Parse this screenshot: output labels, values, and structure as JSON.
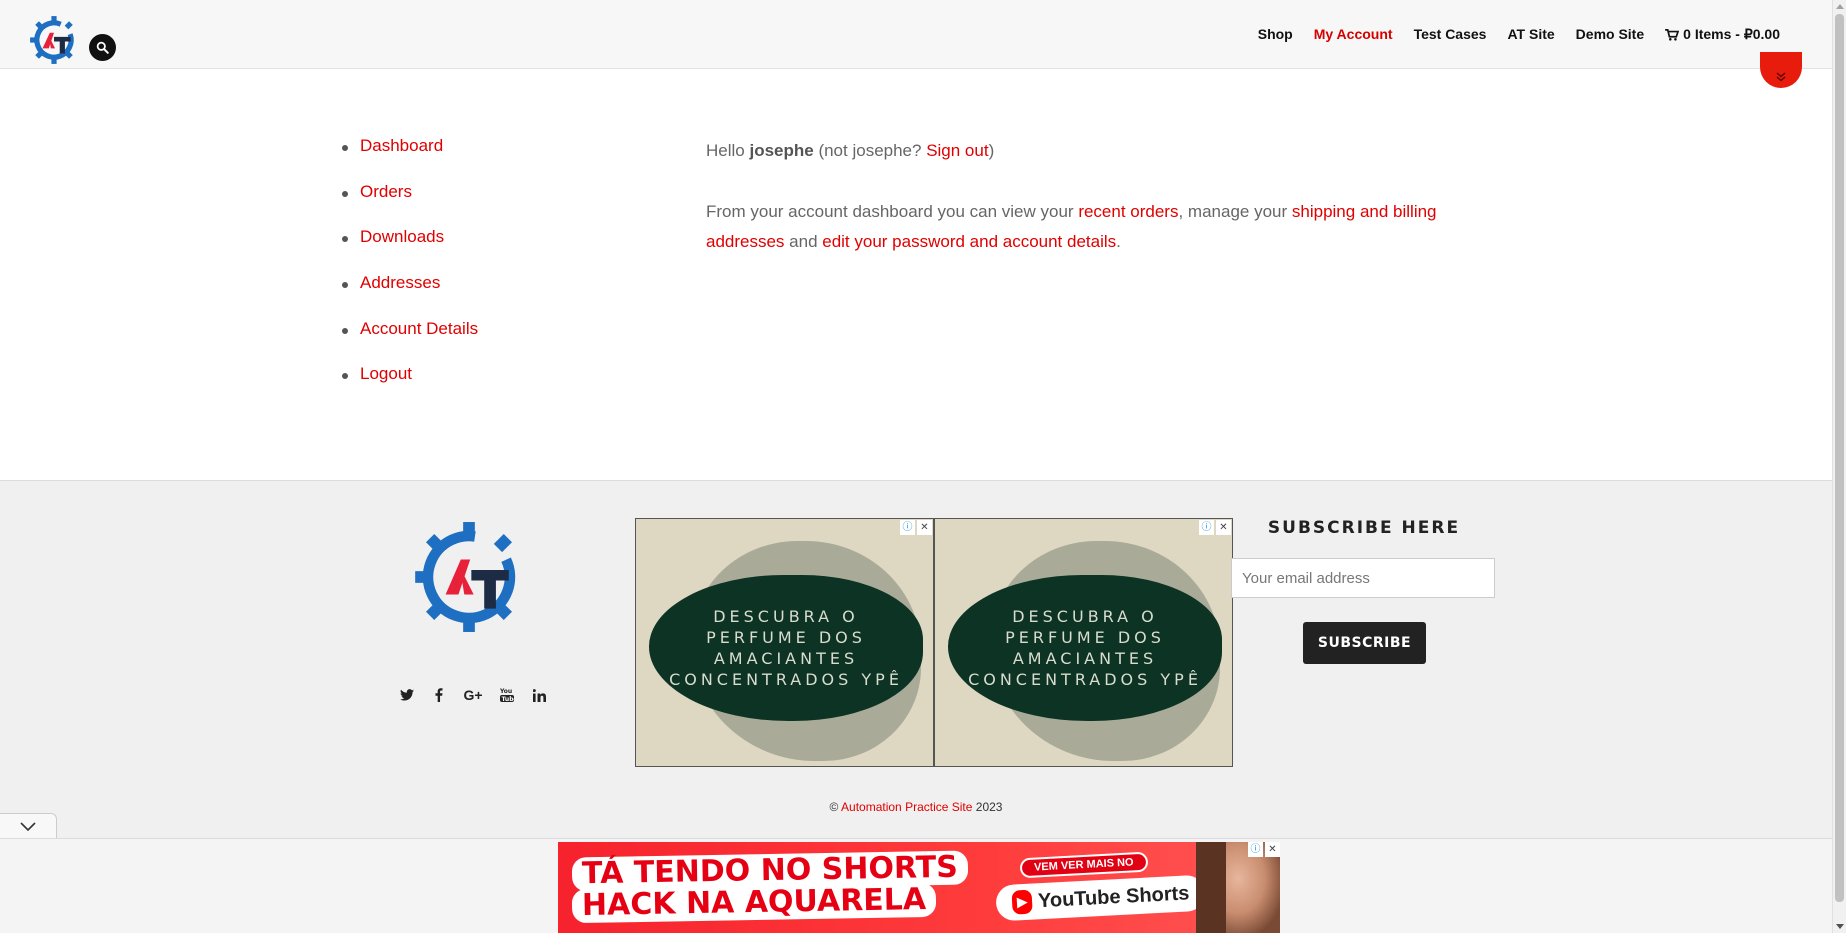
{
  "header": {
    "nav": [
      "Shop",
      "My Account",
      "Test Cases",
      "AT Site",
      "Demo Site"
    ],
    "cart_label": "0 Items - ₽0.00",
    "active_item": "My Account",
    "accent": "#d50000"
  },
  "account_nav": [
    "Dashboard",
    "Orders",
    "Downloads",
    "Addresses",
    "Account Details",
    "Logout"
  ],
  "greeting": {
    "hello": "Hello ",
    "username": "josephe",
    "not_prefix": " (not josephe? ",
    "sign_out": "Sign out",
    "close_paren": ")"
  },
  "dashboard_text": {
    "part1": "From your account dashboard you can view your ",
    "recent_orders": "recent orders",
    "part2": ", manage your ",
    "addresses_link": "shipping and billing addresses",
    "part3": " and ",
    "account_link": "edit your password and account details",
    "part4": "."
  },
  "footer": {
    "social_icons": [
      "twitter-icon",
      "facebook-icon",
      "google-plus-icon",
      "youtube-icon",
      "linkedin-icon"
    ],
    "ads": [
      {
        "text": "DESCUBRA O PERFUME DOS AMACIANTES CONCENTRADOS YPÊ"
      },
      {
        "text": "DESCUBRA O PERFUME DOS AMACIANTES CONCENTRADOS YPÊ"
      }
    ],
    "subscribe_title": "SUBSCRIBE HERE",
    "email_placeholder": "Your email address",
    "subscribe_button": "SUBSCRIBE",
    "copyright_symbol": "© ",
    "copyright_link": "Automation Practice Site",
    "copyright_year": " 2023"
  },
  "banner": {
    "line1": "TÁ TENDO NO SHORTS",
    "line2": "HACK NA AQUARELA",
    "watch": "VEM VER MAIS NO",
    "yt": "YouTube Shorts"
  }
}
